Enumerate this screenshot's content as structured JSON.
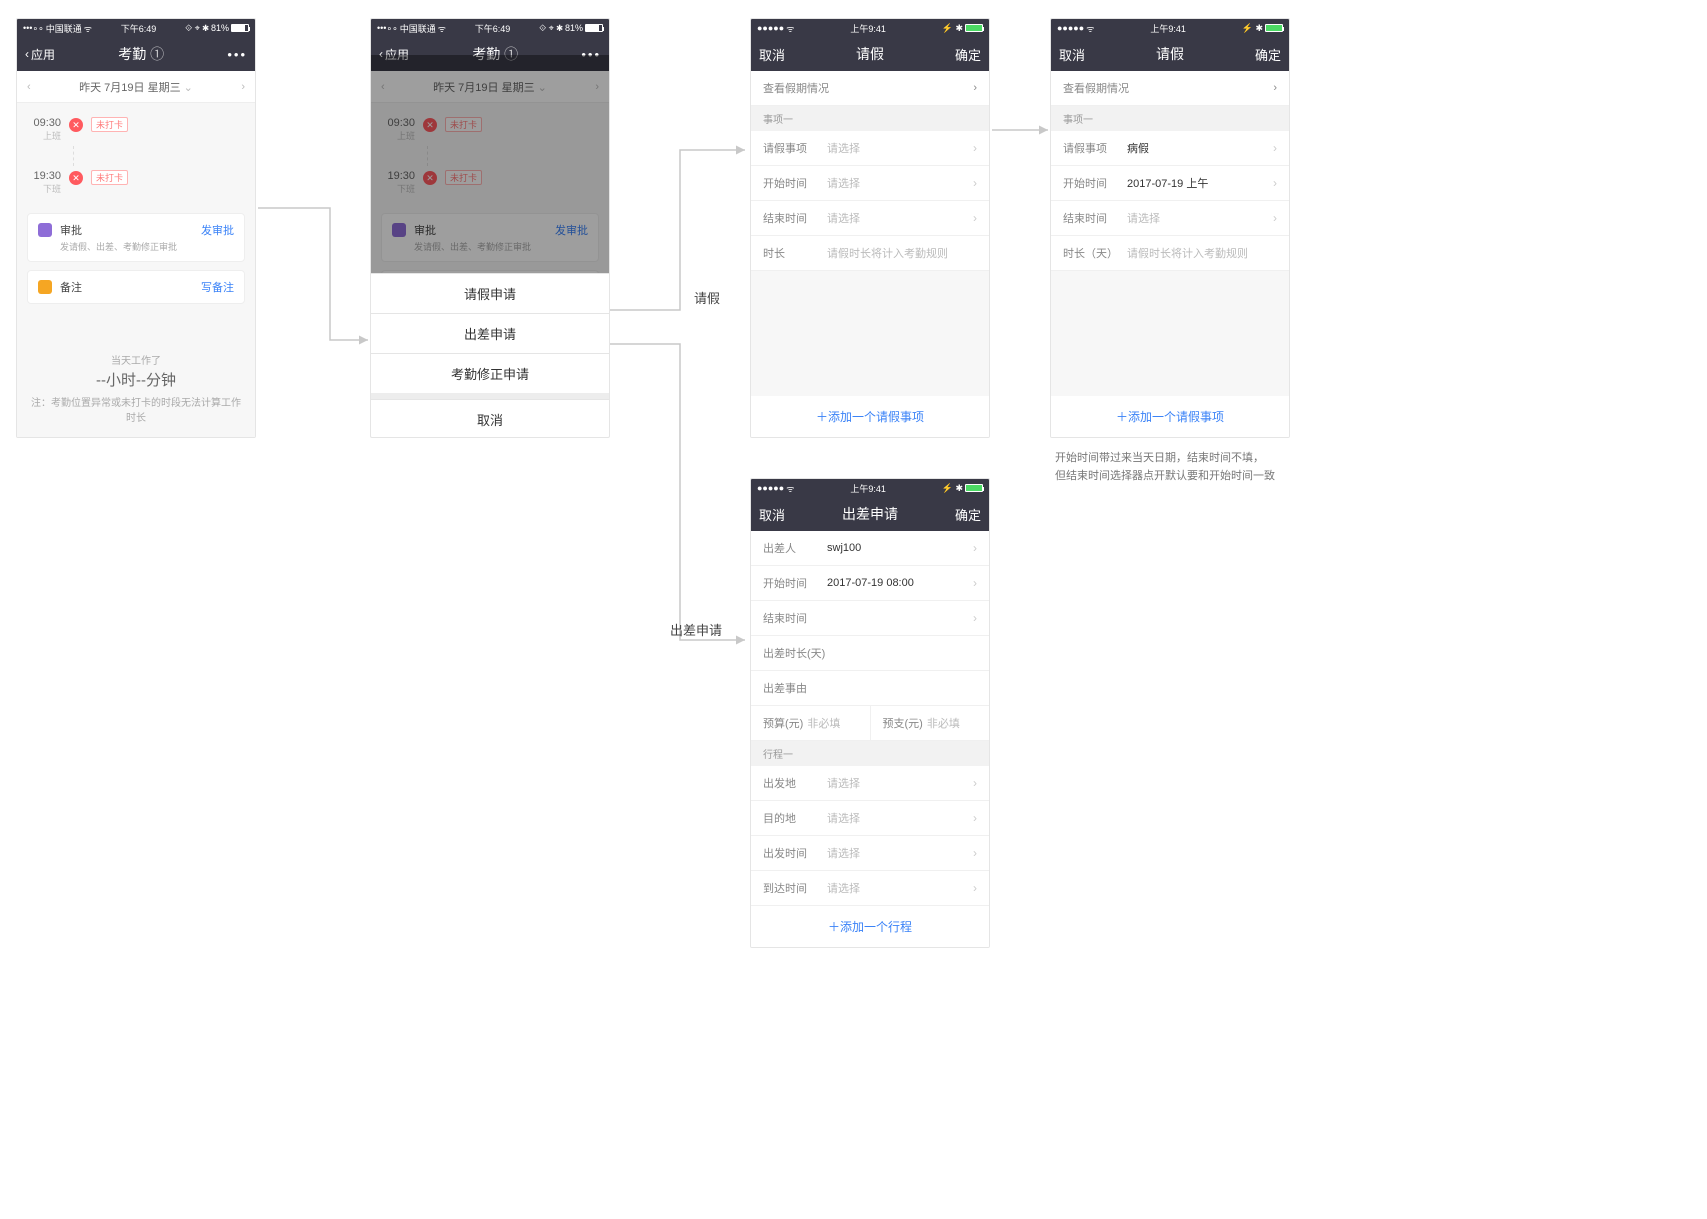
{
  "screen1": {
    "status": {
      "carrier": "中国联通",
      "time": "下午6:49",
      "battery_pct": "81%"
    },
    "nav": {
      "back": "应用",
      "title": "考勤",
      "badge": "①"
    },
    "date": {
      "label": "昨天  7月19日 星期三"
    },
    "timeline": {
      "t1_time": "09:30",
      "t1_sub": "上班",
      "t1_tag": "未打卡",
      "t2_time": "19:30",
      "t2_sub": "下班",
      "t2_tag": "未打卡"
    },
    "card_approval": {
      "title": "审批",
      "sub": "发请假、出差、考勤修正审批",
      "action": "发审批"
    },
    "card_note": {
      "title": "备注",
      "action": "写备注"
    },
    "footer": {
      "line1": "当天工作了",
      "big": "--小时--分钟",
      "note": "注：考勤位置异常或未打卡的时段无法计算工作时长"
    }
  },
  "screen2": {
    "status": {
      "carrier": "中国联通",
      "time": "下午6:49",
      "battery_pct": "81%"
    },
    "nav": {
      "back": "应用",
      "title": "考勤",
      "badge": "①"
    },
    "date": {
      "label": "昨天  7月19日 星期三"
    },
    "timeline": {
      "t1_time": "09:30",
      "t1_sub": "上班",
      "t1_tag": "未打卡",
      "t2_time": "19:30",
      "t2_sub": "下班",
      "t2_tag": "未打卡"
    },
    "card_approval": {
      "title": "审批",
      "sub": "发请假、出差、考勤修正审批",
      "action": "发审批"
    },
    "card_note": {
      "title": "备注",
      "action": "写备注"
    },
    "sheet": {
      "opt1": "请假申请",
      "opt2": "出差申请",
      "opt3": "考勤修正申请",
      "cancel": "取消"
    }
  },
  "screen3": {
    "status": {
      "carrier_dots": "●●●●●",
      "time": "上午9:41"
    },
    "nav": {
      "cancel": "取消",
      "title": "请假",
      "confirm": "确定"
    },
    "link_row": "查看假期情况",
    "section": "事项一",
    "rows": {
      "type_label": "请假事项",
      "type_value": "请选择",
      "start_label": "开始时间",
      "start_value": "请选择",
      "end_label": "结束时间",
      "end_value": "请选择",
      "dur_label": "时长",
      "dur_value": "请假时长将计入考勤规则"
    },
    "add": "＋添加一个请假事项"
  },
  "screen4": {
    "status": {
      "carrier_dots": "●●●●●",
      "time": "上午9:41"
    },
    "nav": {
      "cancel": "取消",
      "title": "请假",
      "confirm": "确定"
    },
    "link_row": "查看假期情况",
    "section": "事项一",
    "rows": {
      "type_label": "请假事项",
      "type_value": "病假",
      "start_label": "开始时间",
      "start_value": "2017-07-19 上午",
      "end_label": "结束时间",
      "end_value": "请选择",
      "dur_label": "时长（天）",
      "dur_value": "请假时长将计入考勤规则"
    },
    "add": "＋添加一个请假事项",
    "note_line1": "开始时间带过来当天日期，结束时间不填，",
    "note_line2": "但结束时间选择器点开默认要和开始时间一致"
  },
  "screen5": {
    "status": {
      "carrier_dots": "●●●●●",
      "time": "上午9:41"
    },
    "nav": {
      "cancel": "取消",
      "title": "出差申请",
      "confirm": "确定"
    },
    "rows": {
      "person_label": "出差人",
      "person_value": "swj100",
      "start_label": "开始时间",
      "start_value": "2017-07-19 08:00",
      "end_label": "结束时间",
      "end_value": "",
      "dur_label": "出差时长(天)",
      "dur_value": "",
      "reason_label": "出差事由",
      "reason_value": "",
      "budget_label": "预算(元)",
      "budget_ph": "非必填",
      "budget2_label": "预支(元)",
      "budget2_ph": "非必填"
    },
    "section": "行程一",
    "trip": {
      "from_label": "出发地",
      "from_value": "请选择",
      "to_label": "目的地",
      "to_value": "请选择",
      "depart_label": "出发时间",
      "depart_value": "请选择",
      "arrive_label": "到达时间",
      "arrive_value": "请选择"
    },
    "add": "＋添加一个行程"
  },
  "flow": {
    "label_leave": "请假",
    "label_trip": "出差申请"
  }
}
